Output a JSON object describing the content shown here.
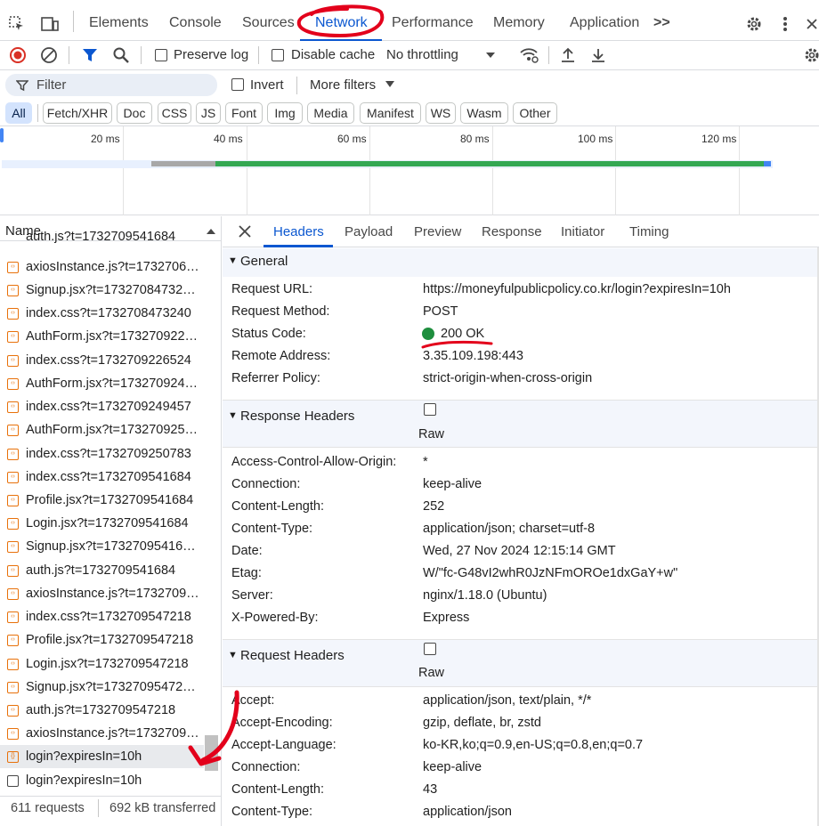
{
  "toolbar": {
    "tabs": [
      "Elements",
      "Console",
      "Sources",
      "Network",
      "Performance",
      "Memory",
      "Application"
    ],
    "more": ">>"
  },
  "net_toolbar": {
    "preserve_log": "Preserve log",
    "disable_cache": "Disable cache",
    "throttling": "No throttling"
  },
  "filter": {
    "placeholder": "Filter",
    "invert": "Invert",
    "more_filters": "More filters"
  },
  "type_chips": [
    "All",
    "Fetch/XHR",
    "Doc",
    "CSS",
    "JS",
    "Font",
    "Img",
    "Media",
    "Manifest",
    "WS",
    "Wasm",
    "Other"
  ],
  "timeline": {
    "ticks": [
      "20 ms",
      "40 ms",
      "60 ms",
      "80 ms",
      "100 ms",
      "120 ms"
    ]
  },
  "list": {
    "header": "Name",
    "rows": [
      "axiosInstance.js?t=1732706…",
      "Signup.jsx?t=17327084732…",
      "index.css?t=1732708473240",
      "AuthForm.jsx?t=173270922…",
      "index.css?t=1732709226524",
      "AuthForm.jsx?t=173270924…",
      "index.css?t=1732709249457",
      "AuthForm.jsx?t=173270925…",
      "index.css?t=1732709250783",
      "index.css?t=1732709541684",
      "Profile.jsx?t=1732709541684",
      "Login.jsx?t=1732709541684",
      "Signup.jsx?t=17327095416…",
      "auth.js?t=1732709541684",
      "axiosInstance.js?t=1732709…",
      "index.css?t=1732709547218",
      "Profile.jsx?t=1732709547218",
      "Login.jsx?t=1732709547218",
      "Signup.jsx?t=17327095472…",
      "auth.js?t=1732709547218",
      "axiosInstance.js?t=1732709…",
      "login?expiresIn=10h",
      "login?expiresIn=10h"
    ],
    "top_partial": "auth.js?t=1732709541684",
    "status_requests": "611 requests",
    "status_transferred": "692 kB transferred"
  },
  "detail": {
    "tabs": [
      "Headers",
      "Payload",
      "Preview",
      "Response",
      "Initiator",
      "Timing"
    ],
    "general_title": "General",
    "general": [
      [
        "Request URL:",
        "https://moneyfulpublicpolicy.co.kr/login?expiresIn=10h"
      ],
      [
        "Request Method:",
        "POST"
      ],
      [
        "Status Code:",
        "200 OK"
      ],
      [
        "Remote Address:",
        "3.35.109.198:443"
      ],
      [
        "Referrer Policy:",
        "strict-origin-when-cross-origin"
      ]
    ],
    "response_title": "Response Headers",
    "raw": "Raw",
    "response": [
      [
        "Access-Control-Allow-Origin:",
        "*"
      ],
      [
        "Connection:",
        "keep-alive"
      ],
      [
        "Content-Length:",
        "252"
      ],
      [
        "Content-Type:",
        "application/json; charset=utf-8"
      ],
      [
        "Date:",
        "Wed, 27 Nov 2024 12:15:14 GMT"
      ],
      [
        "Etag:",
        "W/\"fc-G48vI2whR0JzNFmOROe1dxGaY+w\""
      ],
      [
        "Server:",
        "nginx/1.18.0 (Ubuntu)"
      ],
      [
        "X-Powered-By:",
        "Express"
      ]
    ],
    "request_title": "Request Headers",
    "request": [
      [
        "Accept:",
        "application/json, text/plain, */*"
      ],
      [
        "Accept-Encoding:",
        "gzip, deflate, br, zstd"
      ],
      [
        "Accept-Language:",
        "ko-KR,ko;q=0.9,en-US;q=0.8,en;q=0.7"
      ],
      [
        "Connection:",
        "keep-alive"
      ],
      [
        "Content-Length:",
        "43"
      ],
      [
        "Content-Type:",
        "application/json"
      ]
    ]
  },
  "colors": {
    "accent": "#0b57d0",
    "annotation": "#e3001b",
    "status_ok": "#1e8e3e"
  }
}
